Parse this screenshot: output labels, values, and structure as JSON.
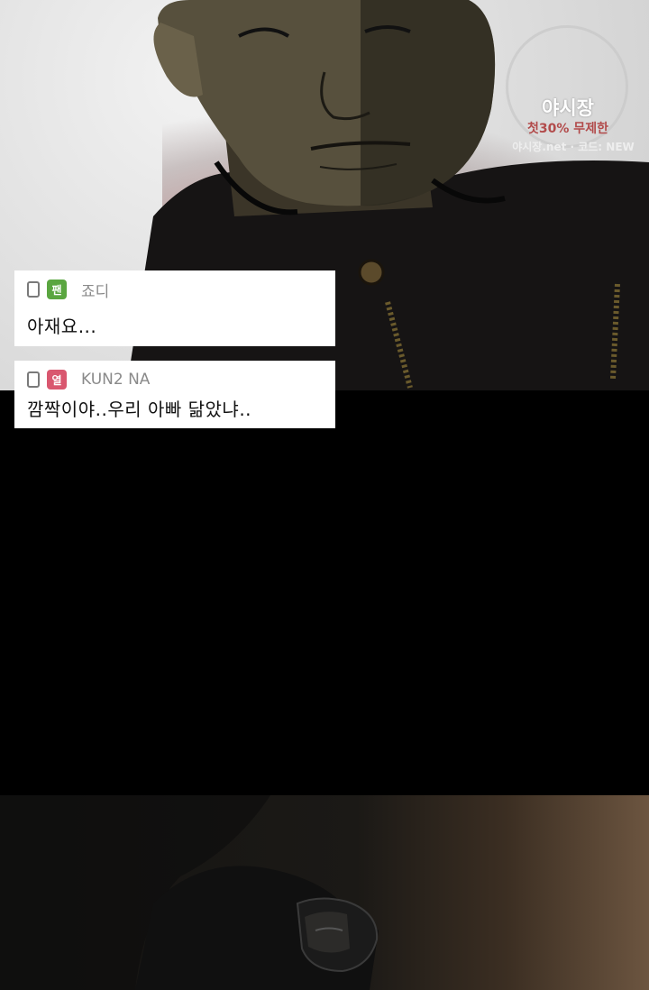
{
  "watermark": {
    "title": "야시장",
    "promo": "첫30% 무제한",
    "code_line": "야시장.net · 코드: NEW"
  },
  "comments": [
    {
      "device_icon": "phone-icon",
      "badge_label": "팬",
      "badge_color": "#5aa640",
      "username": "죠디",
      "text": "아재요..."
    },
    {
      "device_icon": "phone-icon",
      "badge_label": "열",
      "badge_color": "#d9576f",
      "username": "KUN2 NA",
      "text": "깜짝이야..우리 아빠 닮았냐.."
    }
  ],
  "colors": {
    "background": "#000000",
    "card": "#ffffff"
  }
}
